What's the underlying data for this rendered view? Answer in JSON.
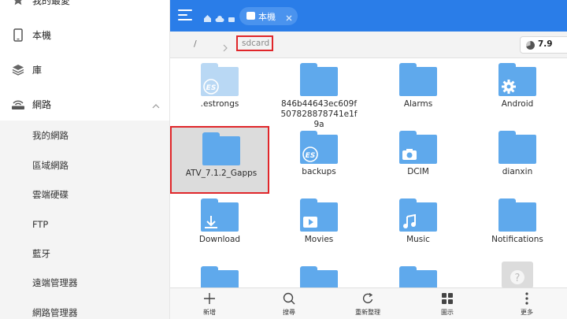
{
  "sidebar": {
    "items": [
      {
        "label": "我的最愛",
        "icon": "star-icon"
      },
      {
        "label": "本機",
        "icon": "phone-icon"
      },
      {
        "label": "庫",
        "icon": "layers-icon"
      },
      {
        "label": "網路",
        "icon": "router-icon"
      }
    ],
    "network_subitems": [
      "我的網路",
      "區域網路",
      "雲端硬碟",
      "FTP",
      "藍牙",
      "遠端管理器",
      "網路管理器"
    ]
  },
  "topbar": {
    "tab_label": "本機",
    "accent_color": "#2a7de8"
  },
  "pathbar": {
    "root": "/",
    "current": "sdcard",
    "storage": "7.9"
  },
  "files": [
    {
      "name": ".estrongs",
      "emblem": "es-logo-icon",
      "light": true
    },
    {
      "name": "846b44643ec609f507828878741e1f9a",
      "emblem": "",
      "light": false
    },
    {
      "name": "Alarms",
      "emblem": "",
      "light": false
    },
    {
      "name": "Android",
      "emblem": "android-gear-icon",
      "light": false
    },
    {
      "name": "ATV_7.1.2_Gapps",
      "emblem": "",
      "light": false,
      "selected": true
    },
    {
      "name": "backups",
      "emblem": "es-logo-icon",
      "light": false
    },
    {
      "name": "DCIM",
      "emblem": "camera-icon",
      "light": false
    },
    {
      "name": "dianxin",
      "emblem": "",
      "light": false
    },
    {
      "name": "Download",
      "emblem": "download-icon",
      "light": false
    },
    {
      "name": "Movies",
      "emblem": "play-icon",
      "light": false
    },
    {
      "name": "Music",
      "emblem": "music-note-icon",
      "light": false
    },
    {
      "name": "Notifications",
      "emblem": "",
      "light": false
    }
  ],
  "toolbar": {
    "new_label": "新增",
    "search_label": "搜尋",
    "refresh_label": "重新整理",
    "view_label": "圖示",
    "more_label": "更多"
  }
}
